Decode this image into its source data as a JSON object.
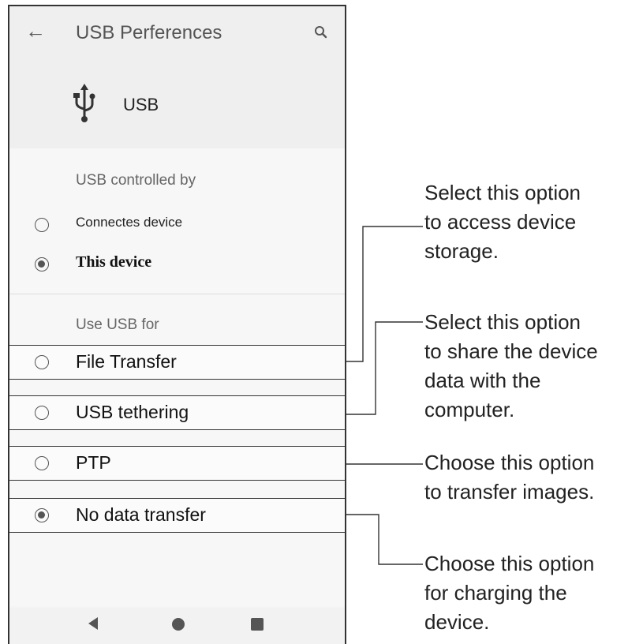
{
  "header": {
    "title": "USB Perferences",
    "back_icon": "arrow-left-icon",
    "search_icon": "search-icon"
  },
  "usb_card": {
    "icon": "usb-icon",
    "label": "USB"
  },
  "controlled_by": {
    "label": "USB controlled by",
    "options": [
      {
        "label": "Connectes device",
        "selected": false
      },
      {
        "label": "This device",
        "selected": true
      }
    ]
  },
  "use_usb_for": {
    "label": "Use USB for",
    "options": [
      {
        "label": "File Transfer",
        "selected": false
      },
      {
        "label": "USB tethering",
        "selected": false
      },
      {
        "label": "PTP",
        "selected": false
      },
      {
        "label": "No data transfer",
        "selected": true
      }
    ]
  },
  "navbar": {
    "icons": [
      "back-triangle-icon",
      "home-circle-icon",
      "recents-square-icon"
    ]
  },
  "callouts": [
    {
      "lines": [
        "Select this option",
        "to access device",
        "storage."
      ]
    },
    {
      "lines": [
        "Select this option",
        "to share the device",
        "data with the",
        "computer."
      ]
    },
    {
      "lines": [
        "Choose this option",
        "to transfer images."
      ]
    },
    {
      "lines": [
        "Choose this option",
        "for charging the",
        "device."
      ]
    }
  ]
}
